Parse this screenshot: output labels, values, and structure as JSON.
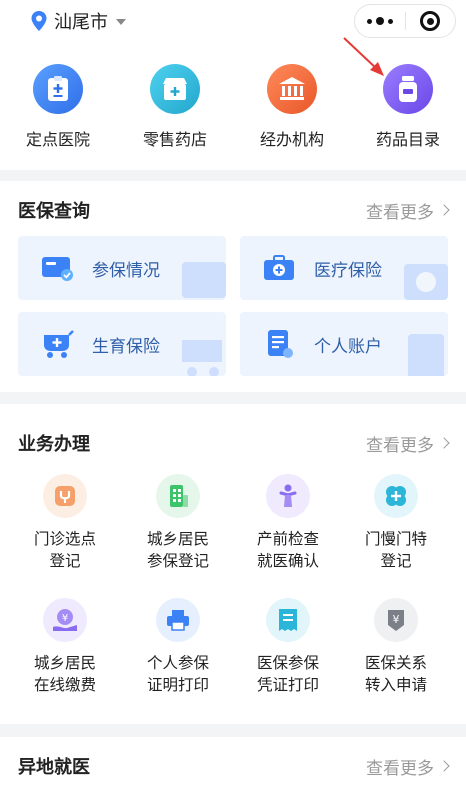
{
  "header": {
    "city": "汕尾市",
    "capsule": {
      "more_icon": "more-dots-icon",
      "close_icon": "close-miniprogram-icon"
    }
  },
  "quick_entries": [
    {
      "label": "定点医院",
      "icon": "hospital-icon",
      "color": "#3b82f6"
    },
    {
      "label": "零售药店",
      "icon": "pharmacy-icon",
      "color": "#2bb5d8"
    },
    {
      "label": "经办机构",
      "icon": "institution-icon",
      "color": "#f26a3c"
    },
    {
      "label": "药品目录",
      "icon": "medicine-bottle-icon",
      "color": "#7b5cf0"
    }
  ],
  "medical_query": {
    "title": "医保查询",
    "more": "查看更多",
    "tiles": [
      {
        "label": "参保情况",
        "icon": "insurance-card-icon"
      },
      {
        "label": "医疗保险",
        "icon": "medical-kit-icon"
      },
      {
        "label": "生育保险",
        "icon": "baby-stroller-icon"
      },
      {
        "label": "个人账户",
        "icon": "account-document-icon"
      }
    ]
  },
  "business": {
    "title": "业务办理",
    "more": "查看更多",
    "items": [
      {
        "line1": "门诊选点",
        "line2": "登记",
        "icon": "stethoscope-icon",
        "color": "#f08a3c",
        "bg": "#fdeee3"
      },
      {
        "line1": "城乡居民",
        "line2": "参保登记",
        "icon": "building-icon",
        "color": "#3cc46a",
        "bg": "#e4f7ea"
      },
      {
        "line1": "产前检查",
        "line2": "就医确认",
        "icon": "pregnant-person-icon",
        "color": "#8a6cf0",
        "bg": "#efeafd"
      },
      {
        "line1": "门慢门特",
        "line2": "登记",
        "icon": "medical-cross-icon",
        "color": "#2bb5d8",
        "bg": "#e2f5fa"
      },
      {
        "line1": "城乡居民",
        "line2": "在线缴费",
        "icon": "payment-hand-icon",
        "color": "#8a6cf0",
        "bg": "#efeafd"
      },
      {
        "line1": "个人参保",
        "line2": "证明打印",
        "icon": "printer-icon",
        "color": "#3b82f6",
        "bg": "#e6effd"
      },
      {
        "line1": "医保参保",
        "line2": "凭证打印",
        "icon": "receipt-icon",
        "color": "#2bb5d8",
        "bg": "#e2f5fa"
      },
      {
        "line1": "医保关系",
        "line2": "转入申请",
        "icon": "transfer-yuan-icon",
        "color": "#7a7f88",
        "bg": "#eef0f2"
      }
    ]
  },
  "remote": {
    "title": "异地就医",
    "more": "查看更多"
  }
}
